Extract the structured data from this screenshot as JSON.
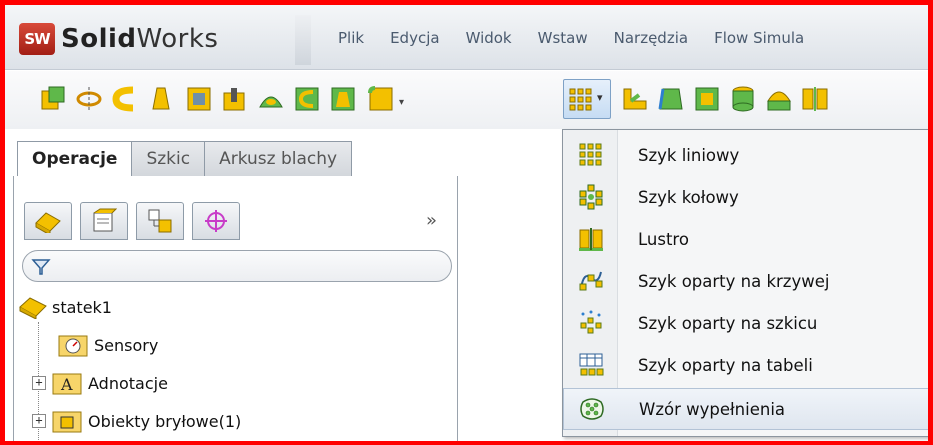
{
  "app": {
    "logo_badge": "SW",
    "logo_bold": "Solid",
    "logo_rest": "Works"
  },
  "menu": [
    {
      "label": "Plik"
    },
    {
      "label": "Edycja"
    },
    {
      "label": "Widok"
    },
    {
      "label": "Wstaw"
    },
    {
      "label": "Narzędzia"
    },
    {
      "label": "Flow Simula"
    }
  ],
  "tabs": [
    {
      "label": "Operacje",
      "active": true
    },
    {
      "label": "Szkic",
      "active": false
    },
    {
      "label": "Arkusz blachy",
      "active": false
    }
  ],
  "panel": {
    "more_label": "»",
    "tree": [
      {
        "label": "statek1",
        "icon": "part-icon",
        "expandable": false
      },
      {
        "label": "Sensory",
        "icon": "sensors-folder-icon",
        "expandable": false
      },
      {
        "label": "Adnotacje",
        "icon": "annotations-folder-icon",
        "expandable": true
      },
      {
        "label": "Obiekty bryłowe(1)",
        "icon": "solid-bodies-folder-icon",
        "expandable": true
      }
    ]
  },
  "dropdown": {
    "items": [
      {
        "label": "Szyk liniowy",
        "icon": "linear-pattern-icon"
      },
      {
        "label": "Szyk kołowy",
        "icon": "circular-pattern-icon"
      },
      {
        "label": "Lustro",
        "icon": "mirror-icon"
      },
      {
        "label": "Szyk oparty na krzywej",
        "icon": "curve-driven-pattern-icon"
      },
      {
        "label": "Szyk oparty na szkicu",
        "icon": "sketch-driven-pattern-icon"
      },
      {
        "label": "Szyk oparty na tabeli",
        "icon": "table-driven-pattern-icon"
      },
      {
        "label": "Wzór wypełnienia",
        "icon": "fill-pattern-icon",
        "highlighted": true
      }
    ]
  },
  "colors": {
    "frame": "#ff0000",
    "accent_blue": "#7ea1c6",
    "menu_text": "#4a5a6e"
  }
}
